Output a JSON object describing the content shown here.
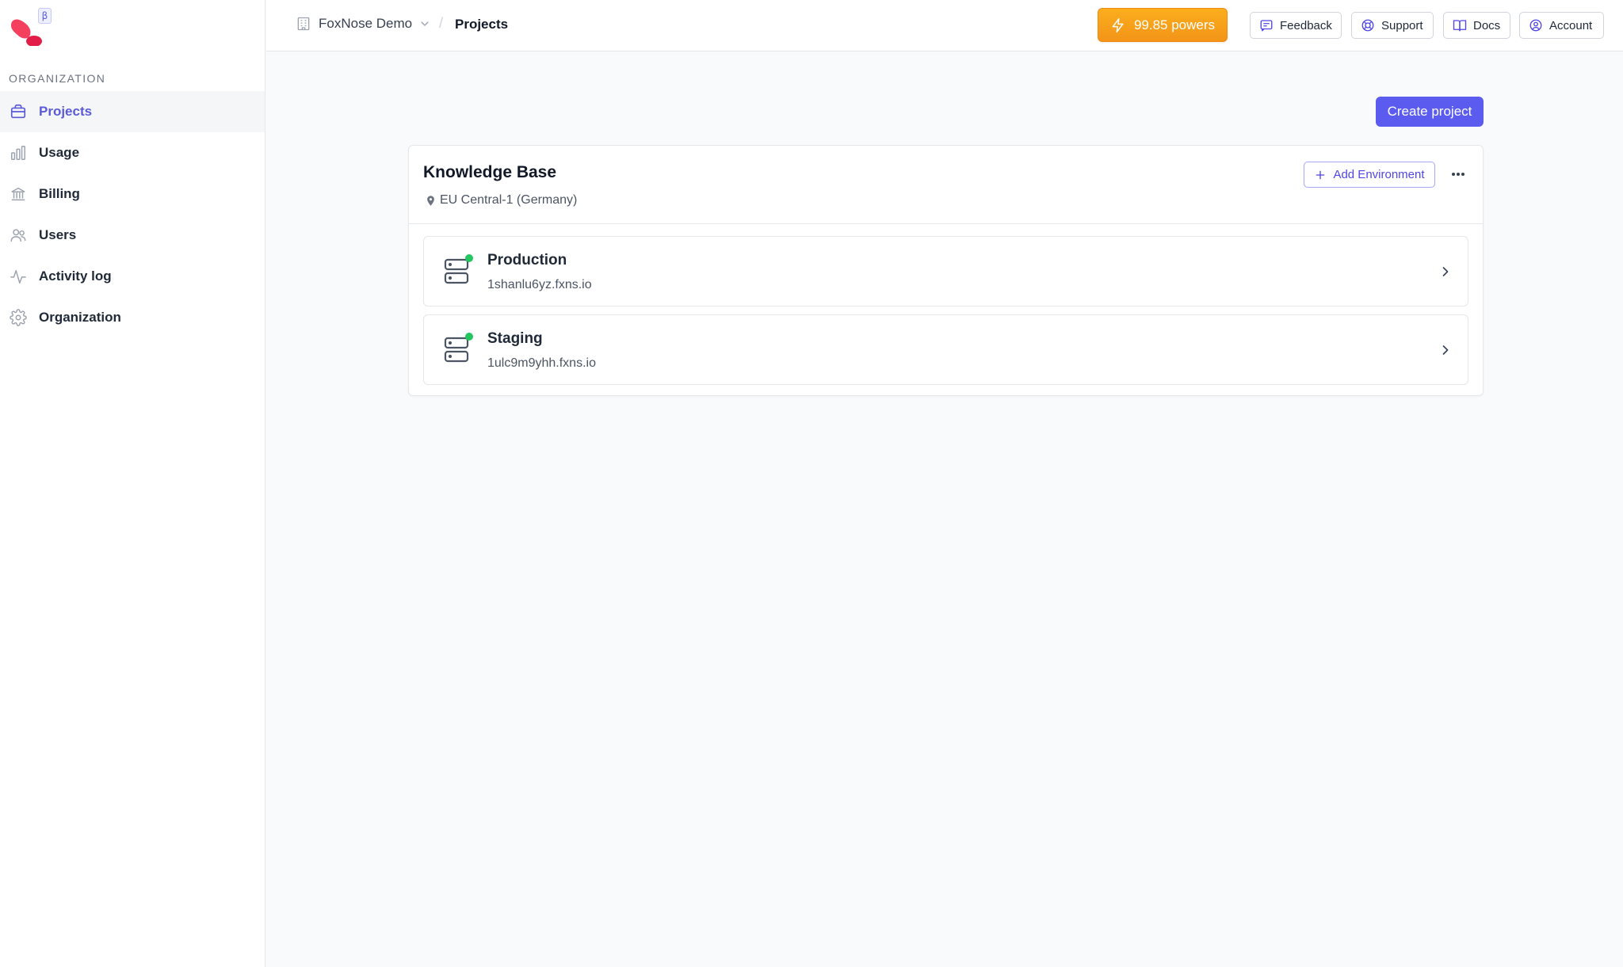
{
  "brand": {
    "beta_badge": "β",
    "colors": {
      "logo_primary": "#f43f5e",
      "logo_secondary": "#e11d48",
      "accent": "#5b5bd6"
    }
  },
  "sidebar": {
    "section_label": "ORGANIZATION",
    "items": [
      {
        "label": "Projects",
        "icon": "briefcase-icon",
        "active": true
      },
      {
        "label": "Usage",
        "icon": "bar-chart-icon",
        "active": false
      },
      {
        "label": "Billing",
        "icon": "bank-icon",
        "active": false
      },
      {
        "label": "Users",
        "icon": "users-icon",
        "active": false
      },
      {
        "label": "Activity log",
        "icon": "activity-icon",
        "active": false
      },
      {
        "label": "Organization",
        "icon": "gear-icon",
        "active": false
      }
    ]
  },
  "header": {
    "org_name": "FoxNose Demo",
    "separator": "/",
    "current_page": "Projects",
    "powers_label": "99.85 powers",
    "buttons": {
      "feedback": "Feedback",
      "support": "Support",
      "docs": "Docs",
      "account": "Account"
    },
    "colors": {
      "powers_bg": "#f59e0b"
    }
  },
  "main": {
    "create_project_label": "Create project",
    "project": {
      "title": "Knowledge Base",
      "region": "EU Central-1 (Germany)",
      "add_environment_label": "Add Environment",
      "environments": [
        {
          "name": "Production",
          "host": "1shanlu6yz.fxns.io",
          "status_color": "#22c55e"
        },
        {
          "name": "Staging",
          "host": "1ulc9m9yhh.fxns.io",
          "status_color": "#22c55e"
        }
      ]
    }
  }
}
